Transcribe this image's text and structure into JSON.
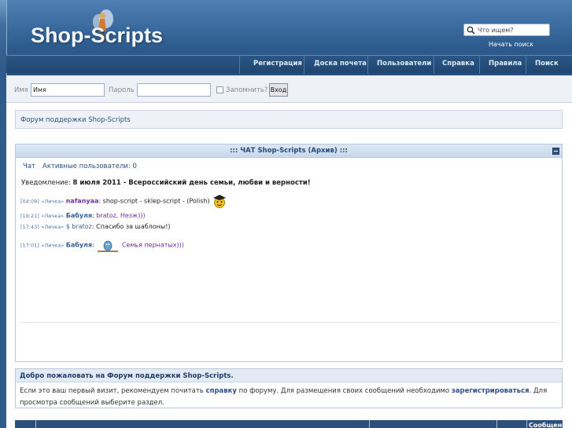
{
  "header": {
    "logo_text": "Shop-Scripts",
    "search_placeholder": "Что ищем?",
    "search_go": "Начать поиск",
    "nav": [
      "Регистрация",
      "Доска почета",
      "Пользователи",
      "Справка",
      "Правила",
      "Поиск"
    ]
  },
  "login": {
    "name_label": "Имя",
    "name_value": "Имя",
    "password_label": "Пароль",
    "remember_label": "Запомнить?",
    "submit_label": "Вход"
  },
  "breadcrumb": "Форум поддержки Shop-Scripts",
  "chat": {
    "title": "::: ЧАТ Shop-Scripts (Архив) :::",
    "tabs": [
      "Чат",
      "Активные пользователи: 0"
    ],
    "notice_prefix": "Уведомление:",
    "notice_text": "8 июля 2011 - Всероссийский день семьи, любви и верности!",
    "messages": [
      {
        "time": "[04:09]",
        "pm": "«Личка»",
        "user": "nafanyaa",
        "text": "shop-script - sklep-script - (Polish)"
      },
      {
        "time": "[19:21]",
        "pm": "«Личка»",
        "user": "Бабуля",
        "text": "bratoz, Незж)))"
      },
      {
        "time": "[17:43]",
        "pm": "«Личка»",
        "user": "$ bratoz",
        "text": "Спасибо за шаблоны!)"
      },
      {
        "time": "[17:01]",
        "pm": "«Личка»",
        "user": "Бабуля",
        "text": "Семья пернатых)))"
      }
    ]
  },
  "welcome": {
    "title": "Добро пожаловать на Форум поддержки Shop-Scripts.",
    "text_1": "Если это ваш первый визит, рекомендуем почитать",
    "link_1": "справку",
    "text_2": "по форуму. Для размещения своих сообщений необходимо",
    "link_2": "зарегистрироваться",
    "text_3": ". Для просмотра сообщений выберите раздел."
  },
  "forum_table": {
    "column_label": "Сообщени"
  }
}
